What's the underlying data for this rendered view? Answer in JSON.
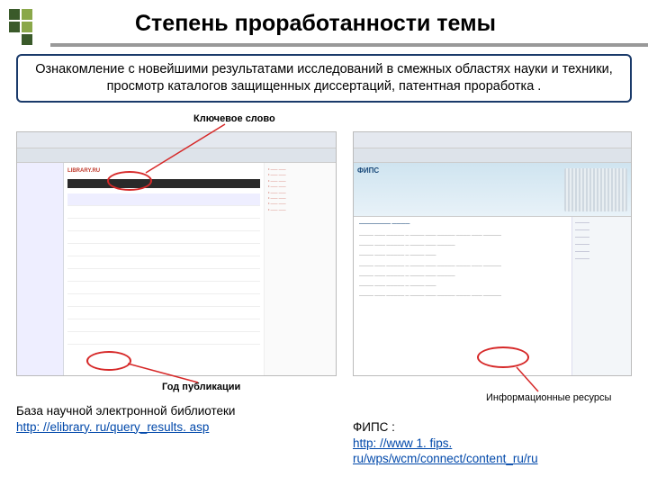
{
  "title": "Степень проработанности темы",
  "intro": "Ознакомление с новейшими результатами исследований в смежных областях науки и техники, просмотр каталогов защищенных диссертаций, патентная проработка .",
  "labels": {
    "keyword": "Ключевое слово",
    "year": "Год публикации",
    "resources": "Информационные ресурсы"
  },
  "left": {
    "library_logo": "LIBRARY.RU",
    "caption": "База научной электронной библиотеки",
    "url": "http: //elibrary. ru/query_results. asp"
  },
  "right": {
    "hero": "ФИПС",
    "caption": "ФИПС :",
    "url": "http: //www 1. fips. ru/wps/wcm/connect/content_ru/ru"
  }
}
